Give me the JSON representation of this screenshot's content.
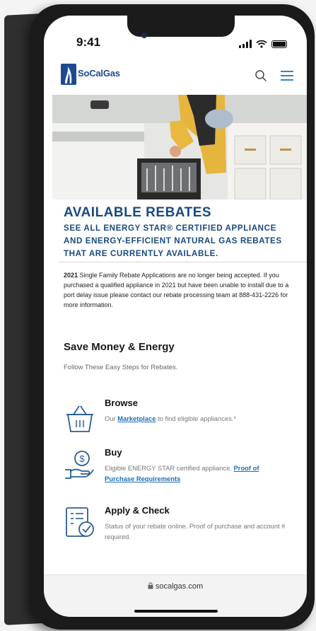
{
  "status_bar": {
    "time": "9:41"
  },
  "header": {
    "logo_text": "SoCalGas"
  },
  "hero": {
    "title": "AVAILABLE REBATES",
    "subtitle": "SEE ALL ENERGY STAR® CERTIFIED APPLIANCE AND ENERGY-EFFICIENT NATURAL GAS REBATES THAT ARE CURRENTLY AVAILABLE."
  },
  "notice": {
    "year": "2021",
    "text": " Single Family Rebate Applications are no longer being accepted. If you purchased a qualified appliance in 2021 but have been unable to install due to a port delay issue please contact our rebate processing team at 888-431-2226 for more information."
  },
  "section": {
    "title": "Save Money & Energy",
    "subtitle": "Follow These Easy Steps for Rebates."
  },
  "steps": [
    {
      "title": "Browse",
      "desc_before": "Our ",
      "link": "Marketplace",
      "desc_after": " to find eligible appliances.*",
      "icon": "basket-icon"
    },
    {
      "title": "Buy",
      "desc_before": "Eligible ENERGY STAR certified appliance. ",
      "link": "Proof of Purchase Requirements",
      "desc_after": "",
      "icon": "hand-dollar-icon"
    },
    {
      "title": "Apply & Check",
      "desc_before": "Status of your rebate online. Proof of purchase and account # required.",
      "link": "",
      "desc_after": "",
      "icon": "checklist-icon"
    }
  ],
  "url_bar": {
    "url": "socalgas.com"
  },
  "colors": {
    "brand_blue": "#18497f",
    "link_blue": "#1d6fb8"
  }
}
